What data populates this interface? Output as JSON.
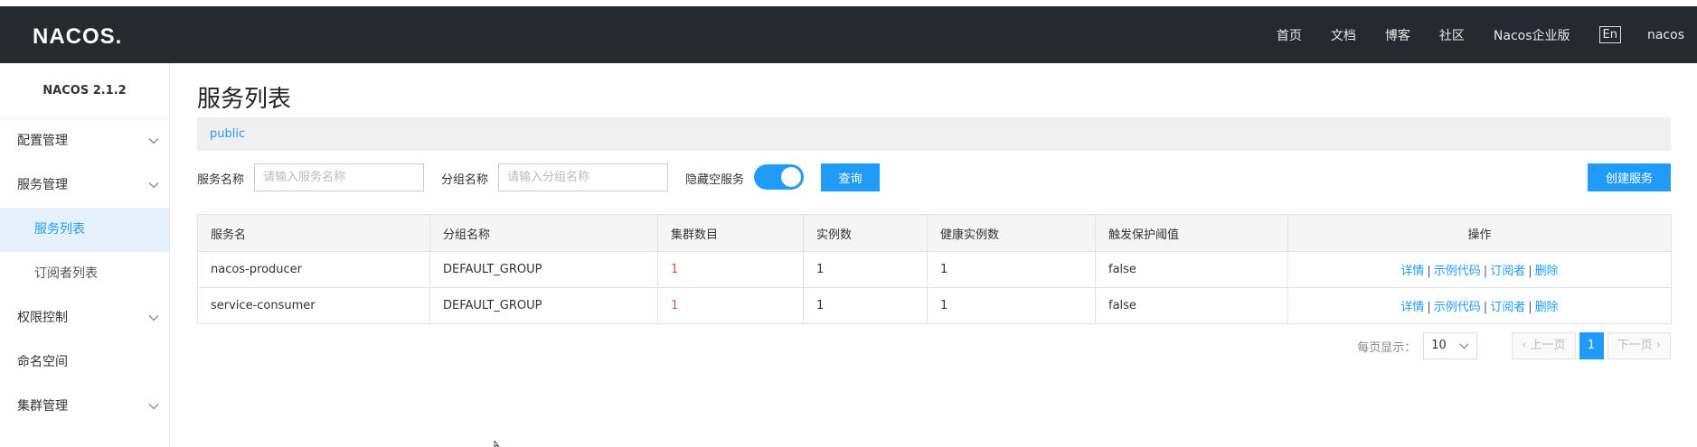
{
  "header": {
    "logo": "NACOS.",
    "nav": [
      "首页",
      "文档",
      "博客",
      "社区",
      "Nacos企业版"
    ],
    "lang": "En",
    "user": "nacos"
  },
  "sidebar": {
    "version": "NACOS 2.1.2",
    "items": [
      {
        "label": "配置管理"
      },
      {
        "label": "服务管理"
      },
      {
        "label": "服务列表"
      },
      {
        "label": "订阅者列表"
      },
      {
        "label": "权限控制"
      },
      {
        "label": "命名空间"
      },
      {
        "label": "集群管理"
      }
    ]
  },
  "main": {
    "title": "服务列表",
    "namespace": "public",
    "filter": {
      "service_label": "服务名称",
      "service_placeholder": "请输入服务名称",
      "group_label": "分组名称",
      "group_placeholder": "请输入分组名称",
      "hide_empty_label": "隐藏空服务",
      "hide_empty_on": true,
      "query_button": "查询",
      "create_button": "创建服务"
    },
    "table": {
      "headers": [
        "服务名",
        "分组名称",
        "集群数目",
        "实例数",
        "健康实例数",
        "触发保护阈值",
        "操作"
      ],
      "rows": [
        {
          "name": "nacos-producer",
          "group": "DEFAULT_GROUP",
          "clusters": "1",
          "instances": "1",
          "healthy": "1",
          "threshold": "false"
        },
        {
          "name": "service-consumer",
          "group": "DEFAULT_GROUP",
          "clusters": "1",
          "instances": "1",
          "healthy": "1",
          "threshold": "false"
        }
      ],
      "ops": {
        "detail": "详情",
        "sample": "示例代码",
        "subscriber": "订阅者",
        "delete": "删除",
        "sep": "|"
      }
    },
    "pagination": {
      "per_page_label": "每页显示：",
      "per_page": "10",
      "prev": "上一页",
      "current": "1",
      "next": "下一页"
    }
  },
  "colors": {
    "primary": "#209bfa",
    "topbar": "#262a30",
    "active_bg": "#e5f1fd",
    "red_value": "#d9534f"
  }
}
